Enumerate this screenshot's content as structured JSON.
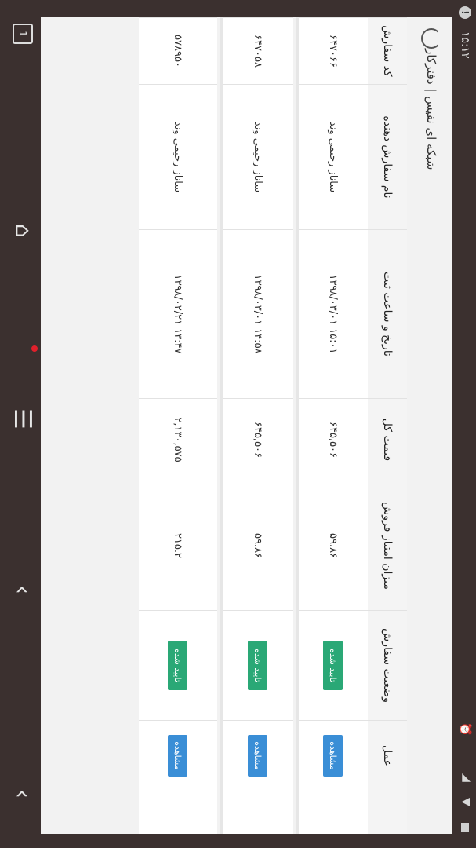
{
  "status": {
    "time": "۱۵:۱۲"
  },
  "app": {
    "title": "شبکه ای نفیس | دفترکار"
  },
  "table": {
    "headers": {
      "code": "کد سفارش",
      "customer": "نام سفارش دهنده",
      "date": "تاریخ و ساعت ثبت",
      "total": "قیمت کل",
      "score": "میزان امتیاز فروش",
      "status": "وضعیت سفارش",
      "actions": "عمل"
    },
    "rows": [
      {
        "code": "۶۴۷۰۶۶",
        "customer": "ساناز رحیمی وند",
        "date": "۱۳۹۸/۰۳/۰۱ ۱۵:۰۱",
        "total": "۶۴۵,۵۰۶",
        "score": "۵۹.۸۶",
        "status": "تایید شده",
        "action": "مشاهده"
      },
      {
        "code": "۶۴۷۰۵۸",
        "customer": "ساناز رحیمی وند",
        "date": "۱۳۹۸/۰۳/۰۱ ۱۴:۵۸",
        "total": "۶۴۵,۵۰۶",
        "score": "۵۹.۸۶",
        "status": "تایید شده",
        "action": "مشاهده"
      },
      {
        "code": "۵۷۸۹۵۰",
        "customer": "ساناز رحیمی وند",
        "date": "۱۳۹۸/۰۲/۲۱ ۱۳:۴۷",
        "total": "۲,۱۳۰,۵۷۵",
        "score": "۲۱۵.۲",
        "status": "تایید شده",
        "action": "مشاهده"
      }
    ]
  },
  "nav": {
    "recents_count": "1"
  },
  "colors": {
    "status_badge": "#2aa876",
    "action_button": "#3a8ed6"
  }
}
